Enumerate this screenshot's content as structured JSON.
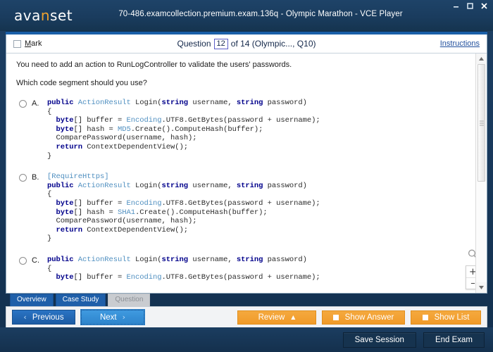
{
  "window": {
    "title": "70-486.examcollection.premium.exam.136q - Olympic Marathon - VCE Player",
    "logo_main_1": "ava",
    "logo_accent": "n",
    "logo_main_2": "set",
    "minimize": "–",
    "maximize": "□",
    "close": "✕"
  },
  "toolbar": {
    "mark_prefix": "M",
    "mark_rest": "ark",
    "question_label": "Question",
    "question_number": "12",
    "question_of": "of 14 (Olympic..., Q10)",
    "instructions": "Instructions"
  },
  "question": {
    "line1": "You need to add an action to RunLogController to validate the users' passwords.",
    "line2": "Which code segment should you use?"
  },
  "options": [
    {
      "letter": "A.",
      "lines": [
        [
          {
            "t": "public ",
            "c": "kw"
          },
          {
            "t": "ActionResult ",
            "c": "type"
          },
          {
            "t": "Login(",
            "c": "plain"
          },
          {
            "t": "string ",
            "c": "kw"
          },
          {
            "t": "username, ",
            "c": "plain"
          },
          {
            "t": "string ",
            "c": "kw"
          },
          {
            "t": "password)",
            "c": "plain"
          }
        ],
        [
          {
            "t": "{",
            "c": "plain"
          }
        ],
        [
          {
            "t": "  byte",
            "c": "kw"
          },
          {
            "t": "[] buffer = ",
            "c": "plain"
          },
          {
            "t": "Encoding",
            "c": "type"
          },
          {
            "t": ".UTF8.GetBytes(password + username);",
            "c": "plain"
          }
        ],
        [
          {
            "t": "  byte",
            "c": "kw"
          },
          {
            "t": "[] hash = ",
            "c": "plain"
          },
          {
            "t": "MD5",
            "c": "type"
          },
          {
            "t": ".Create().ComputeHash(buffer);",
            "c": "plain"
          }
        ],
        [
          {
            "t": "  ComparePassword(username, hash);",
            "c": "plain"
          }
        ],
        [
          {
            "t": "  return ",
            "c": "kw"
          },
          {
            "t": "ContextDependentView();",
            "c": "plain"
          }
        ],
        [
          {
            "t": "}",
            "c": "plain"
          }
        ]
      ]
    },
    {
      "letter": "B.",
      "lines": [
        [
          {
            "t": "[RequireHttps]",
            "c": "attr"
          }
        ],
        [
          {
            "t": "public ",
            "c": "kw"
          },
          {
            "t": "ActionResult ",
            "c": "type"
          },
          {
            "t": "Login(",
            "c": "plain"
          },
          {
            "t": "string ",
            "c": "kw"
          },
          {
            "t": "username, ",
            "c": "plain"
          },
          {
            "t": "string ",
            "c": "kw"
          },
          {
            "t": "password)",
            "c": "plain"
          }
        ],
        [
          {
            "t": "{",
            "c": "plain"
          }
        ],
        [
          {
            "t": "  byte",
            "c": "kw"
          },
          {
            "t": "[] buffer = ",
            "c": "plain"
          },
          {
            "t": "Encoding",
            "c": "type"
          },
          {
            "t": ".UTF8.GetBytes(password + username);",
            "c": "plain"
          }
        ],
        [
          {
            "t": "  byte",
            "c": "kw"
          },
          {
            "t": "[] hash = ",
            "c": "plain"
          },
          {
            "t": "SHA1",
            "c": "type"
          },
          {
            "t": ".Create().ComputeHash(buffer);",
            "c": "plain"
          }
        ],
        [
          {
            "t": "  ComparePassword(username, hash);",
            "c": "plain"
          }
        ],
        [
          {
            "t": "  return ",
            "c": "kw"
          },
          {
            "t": "ContextDependentView();",
            "c": "plain"
          }
        ],
        [
          {
            "t": "}",
            "c": "plain"
          }
        ]
      ]
    },
    {
      "letter": "C.",
      "lines": [
        [
          {
            "t": "public ",
            "c": "kw"
          },
          {
            "t": "ActionResult ",
            "c": "type"
          },
          {
            "t": "Login(",
            "c": "plain"
          },
          {
            "t": "string ",
            "c": "kw"
          },
          {
            "t": "username, ",
            "c": "plain"
          },
          {
            "t": "string ",
            "c": "kw"
          },
          {
            "t": "password)",
            "c": "plain"
          }
        ],
        [
          {
            "t": "{",
            "c": "plain"
          }
        ],
        [
          {
            "t": "  byte",
            "c": "kw"
          },
          {
            "t": "[] buffer = ",
            "c": "plain"
          },
          {
            "t": "Encoding",
            "c": "type"
          },
          {
            "t": ".UTF8.GetBytes(password + username);",
            "c": "plain"
          }
        ]
      ]
    }
  ],
  "zoom_widget": {
    "zoom_in": "+",
    "zoom_out": "–",
    "icon": "magnifier-icon"
  },
  "tabs": [
    {
      "label": "Overview",
      "state": "active"
    },
    {
      "label": "Case Study",
      "state": "active"
    },
    {
      "label": "Question",
      "state": "disabled"
    }
  ],
  "nav": {
    "previous": "Previous",
    "next": "Next",
    "prev_chevron": "‹",
    "next_chevron": "›",
    "review": "Review",
    "review_caret": "▲",
    "show_answer": "Show Answer",
    "show_list": "Show List"
  },
  "footer": {
    "save_session": "Save Session",
    "end_exam": "End Exam"
  },
  "colors": {
    "titlebar": "#1a3c5e",
    "accent_strip": "#1a5fa8",
    "logo_accent": "#f0a22e",
    "tab_blue": "#1f5fa9",
    "orange": "#f09a28",
    "link_blue": "#1f4e9c",
    "code_keyword": "#00008b",
    "code_type": "#4f8fc0"
  }
}
